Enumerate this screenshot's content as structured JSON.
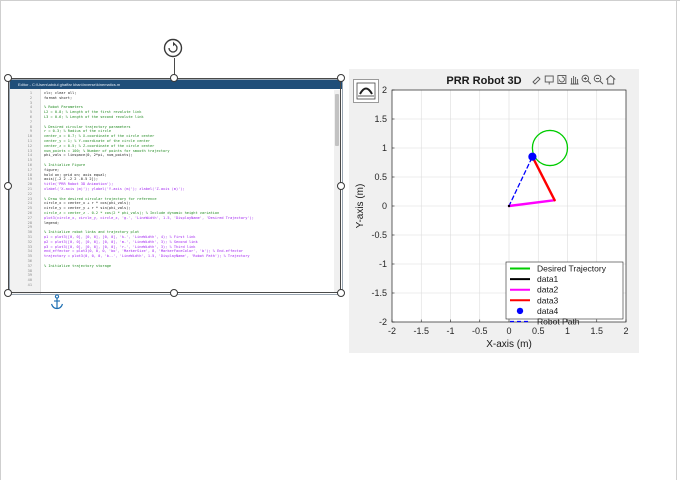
{
  "editor": {
    "title": "Editor - C:\\Users\\abdul ghaffar khan\\inverse\\kinematics.m",
    "line_numbers": [
      "1",
      "2",
      "3",
      "4",
      "5",
      "6",
      "7",
      "8",
      "9",
      "10",
      "11",
      "12",
      "13",
      "14",
      "15",
      "16",
      "17",
      "18",
      "19",
      "20",
      "21",
      "22",
      "23",
      "24",
      "25",
      "26",
      "27",
      "28",
      "29",
      "30",
      "31",
      "32",
      "33",
      "34",
      "35",
      "36",
      "37",
      "38",
      "39",
      "40",
      "41",
      "42"
    ],
    "lines": [
      {
        "text": "clc; clear all;",
        "kind": "code"
      },
      {
        "text": "format short;",
        "kind": "code"
      },
      {
        "text": "",
        "kind": "code"
      },
      {
        "text": "% Robot Parameters",
        "kind": "comment"
      },
      {
        "text": "L2 = 0.8; % Length of the first revolute link",
        "kind": "comment"
      },
      {
        "text": "L3 = 0.6; % Length of the second revolute link",
        "kind": "comment"
      },
      {
        "text": "",
        "kind": "code"
      },
      {
        "text": "% Desired circular trajectory parameters",
        "kind": "comment"
      },
      {
        "text": "r = 0.3; % Radius of the circle",
        "kind": "comment"
      },
      {
        "text": "center_x = 0.7; % X-coordinate of the circle center",
        "kind": "comment"
      },
      {
        "text": "center_y = 1; % Y-coordinate of the circle center",
        "kind": "comment"
      },
      {
        "text": "center_z = 0.5; % Z-coordinate of the circle center",
        "kind": "comment"
      },
      {
        "text": "num_points = 100; % Number of points for smooth trajectory",
        "kind": "comment"
      },
      {
        "text": "phi_vals = linspace(0, 2*pi, num_points);",
        "kind": "code"
      },
      {
        "text": "",
        "kind": "code"
      },
      {
        "text": "% Initialize Figure",
        "kind": "comment"
      },
      {
        "text": "figure;",
        "kind": "code"
      },
      {
        "text": "hold on; grid on; axis equal;",
        "kind": "code"
      },
      {
        "text": "axis([-2 2 -2 2 -0.5 2]);",
        "kind": "code"
      },
      {
        "text": "title('PRR Robot 3D Animation');",
        "kind": "str"
      },
      {
        "text": "xlabel('X-axis (m)'); ylabel('Y-axis (m)'); zlabel('Z-axis (m)');",
        "kind": "str"
      },
      {
        "text": "",
        "kind": "code"
      },
      {
        "text": "% Draw the desired circular trajectory for reference",
        "kind": "comment"
      },
      {
        "text": "circle_x = center_x + r * cos(phi_vals);",
        "kind": "code"
      },
      {
        "text": "circle_y = center_y + r * sin(phi_vals);",
        "kind": "code"
      },
      {
        "text": "circle_z = center_z - 0.2 * cos(2 * phi_vals); % Include dynamic height variation",
        "kind": "comment"
      },
      {
        "text": "plot3(circle_x, circle_y, circle_z, 'g-', 'LineWidth', 1.5, 'DisplayName', 'Desired Trajectory');",
        "kind": "str"
      },
      {
        "text": "legend;",
        "kind": "code"
      },
      {
        "text": "",
        "kind": "code"
      },
      {
        "text": "% Initialize robot links and trajectory plot",
        "kind": "comment"
      },
      {
        "text": "p1 = plot3([0, 0], [0, 0], [0, 0], 'k-', 'LineWidth', 4); % First link",
        "kind": "str"
      },
      {
        "text": "p2 = plot3([0, 0], [0, 0], [0, 0], 'm-', 'LineWidth', 3); % Second link",
        "kind": "str"
      },
      {
        "text": "p3 = plot3([0, 0], [0, 0], [0, 0], 'r-', 'LineWidth', 3); % Third link",
        "kind": "str"
      },
      {
        "text": "end_effector = plot3(0, 0, 0, 'bo', 'MarkerSize', 8, 'MarkerFaceColor', 'b'); % End-effector",
        "kind": "str"
      },
      {
        "text": "trajectory = plot3(0, 0, 0, 'b--', 'LineWidth', 1.5, 'DisplayName', 'Robot Path'); % Trajectory",
        "kind": "str"
      },
      {
        "text": "",
        "kind": "code"
      },
      {
        "text": "% Initialize trajectory storage",
        "kind": "comment"
      }
    ]
  },
  "selection": {
    "rotate_icon": "rotate-icon",
    "anchor_icon": "anchor-icon"
  },
  "figure": {
    "toolbar_icon": "axes-toolbar-icon",
    "axes_toolbar_icons": [
      "brush-icon",
      "data-tips-icon",
      "rotate-3d-icon",
      "pan-icon",
      "zoom-in-icon",
      "zoom-out-icon",
      "home-icon"
    ]
  },
  "chart_data": {
    "type": "line",
    "title": "PRR Robot 3D",
    "xlabel": "X-axis (m)",
    "ylabel": "Y-axis (m)",
    "xlim": [
      -2,
      2
    ],
    "ylim": [
      -2,
      2
    ],
    "xticks": [
      "-2",
      "-1.5",
      "-1",
      "-0.5",
      "0",
      "0.5",
      "1",
      "1.5",
      "2"
    ],
    "yticks": [
      "-2",
      "-1.5",
      "-1",
      "-0.5",
      "0",
      "0.5",
      "1",
      "1.5",
      "2"
    ],
    "grid": true,
    "legend_position": "bottom-right",
    "series": [
      {
        "name": "Desired Trajectory",
        "style": "solid",
        "color": "#00cc00",
        "shape": "circle",
        "center": [
          0.7,
          1.0
        ],
        "radius": 0.3
      },
      {
        "name": "data1",
        "style": "solid",
        "color": "#000000",
        "x": [
          0.0,
          0.0
        ],
        "y": [
          0.0,
          0.0
        ]
      },
      {
        "name": "data2",
        "style": "solid",
        "color": "#ff00ff",
        "x": [
          0.0,
          0.78
        ],
        "y": [
          0.0,
          0.1
        ]
      },
      {
        "name": "data3",
        "style": "solid",
        "color": "#ff0000",
        "x": [
          0.78,
          0.4
        ],
        "y": [
          0.1,
          0.85
        ]
      },
      {
        "name": "data4",
        "style": "marker",
        "color": "#0000ff",
        "x": [
          0.4
        ],
        "y": [
          0.85
        ]
      },
      {
        "name": "Robot Path",
        "style": "dashed",
        "color": "#0000ff",
        "x": [
          0.0,
          0.4
        ],
        "y": [
          0.0,
          0.85
        ]
      }
    ]
  }
}
